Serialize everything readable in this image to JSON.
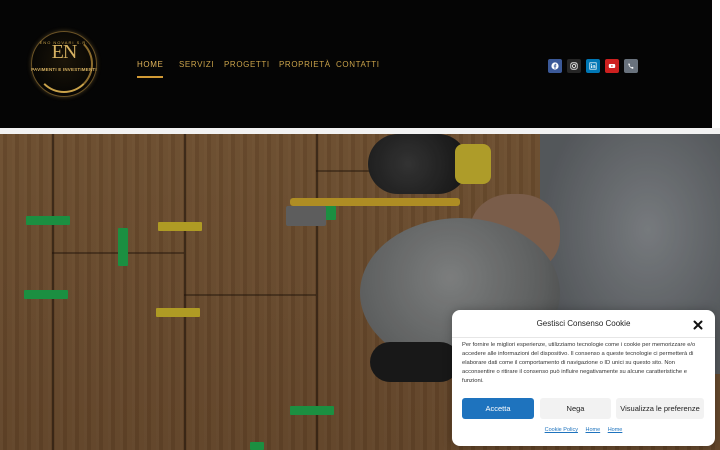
{
  "logo": {
    "monogram": "EN",
    "top_text": "ENO NOVARI S.R.",
    "tagline": "PAVIMENTI E INVESTIMENTI"
  },
  "nav": {
    "items": [
      {
        "label": "HOME",
        "active": true
      },
      {
        "label": "SERVIZI",
        "active": false
      },
      {
        "label": "PROGETTI",
        "active": false
      },
      {
        "label": "PROPRIETÀ",
        "active": false
      },
      {
        "label": "CONTATTI",
        "active": false
      }
    ]
  },
  "social": [
    {
      "name": "facebook-icon",
      "color": "#3b5998"
    },
    {
      "name": "instagram-icon",
      "color": "#262626"
    },
    {
      "name": "linkedin-icon",
      "color": "#0077b5"
    },
    {
      "name": "youtube-icon",
      "color": "#cd201f"
    },
    {
      "name": "phone-icon",
      "color": "#69727d"
    }
  ],
  "colors": {
    "gold": "#c9a24a",
    "header_bg": "#050505",
    "accept_blue": "#1e73be"
  },
  "cookie": {
    "title": "Gestisci Consenso Cookie",
    "text": "Per fornire le migliori esperienze, utilizziamo tecnologie come i cookie per memorizzare e/o accedere alle informazioni del dispositivo. Il consenso a queste tecnologie ci permetterà di elaborare dati come il comportamento di navigazione o ID unici su questo sito. Non acconsentire o ritirare il consenso può influire negativamente su alcune caratteristiche e funzioni.",
    "accept_label": "Accetta",
    "deny_label": "Nega",
    "prefs_label": "Visualizza le preferenze",
    "links": [
      "Cookie Policy",
      "Home",
      "Home"
    ]
  }
}
